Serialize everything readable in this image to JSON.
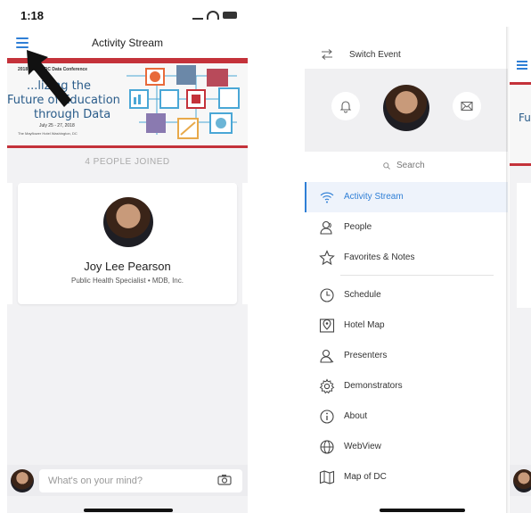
{
  "left_screen": {
    "status_time": "1:18",
    "nav_title": "Activity Stream",
    "banner": {
      "conference_name": "2018 ESMIS-DC Data Conference",
      "tagline_1": "...lizing the",
      "tagline_2": "Future of Education",
      "tagline_3": "through Data",
      "dates": "July 25 - 27, 2018",
      "venue": "The Mayflower Hotel Washington, DC"
    },
    "people_joined": "4 PEOPLE JOINED",
    "card": {
      "name": "Joy Lee Pearson",
      "role": "Public Health Specialist • MDB, Inc."
    },
    "composer_placeholder": "What's on your mind?"
  },
  "menu": {
    "switch_event": "Switch Event",
    "search_label": "Search",
    "items": [
      {
        "label": "Activity Stream",
        "icon": "wifi-icon"
      },
      {
        "label": "People",
        "icon": "people-icon"
      },
      {
        "label": "Favorites & Notes",
        "icon": "star-icon"
      },
      {
        "label": "Schedule",
        "icon": "clock-icon"
      },
      {
        "label": "Hotel Map",
        "icon": "map-pin-icon"
      },
      {
        "label": "Presenters",
        "icon": "presenters-icon"
      },
      {
        "label": "Demonstrators",
        "icon": "gear-icon"
      },
      {
        "label": "About",
        "icon": "info-icon"
      },
      {
        "label": "WebView",
        "icon": "globe-icon"
      },
      {
        "label": "Map of DC",
        "icon": "map-icon"
      }
    ]
  },
  "peek": {
    "banner_fragment": "Fu"
  },
  "colors": {
    "accent": "#2f7fd6",
    "banner_red": "#c4323a",
    "background": "#f2f2f4"
  }
}
